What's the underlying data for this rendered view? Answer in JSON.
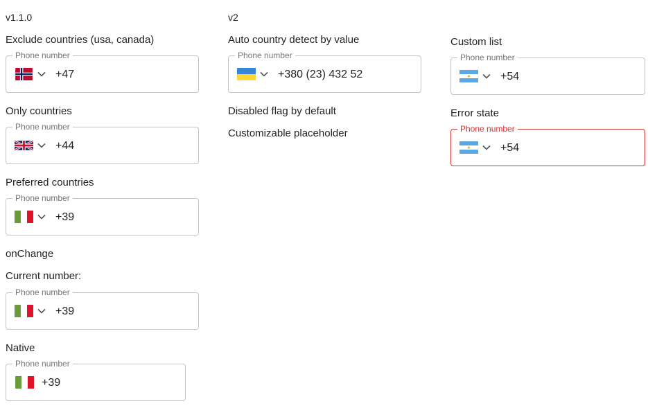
{
  "columns": {
    "v1": {
      "version": "v1.1.0",
      "fields": [
        {
          "label": "Exclude countries (usa, canada)",
          "placeholder": "Phone number",
          "value": "+47",
          "flag": "norway-flag-icon"
        },
        {
          "label": "Only countries",
          "placeholder": "Phone number",
          "value": "+44",
          "flag": "uk-flag-icon"
        },
        {
          "label": "Preferred countries",
          "placeholder": "Phone number",
          "value": "+39",
          "flag": "italy-flag-icon"
        }
      ],
      "onchange": {
        "label": "onChange",
        "current_label": "Current number:",
        "placeholder": "Phone number",
        "value": "+39",
        "flag": "italy-flag-icon"
      },
      "native": {
        "label": "Native",
        "placeholder": "Phone number",
        "value": "+39",
        "flag": "italy-flag-icon"
      }
    },
    "v2": {
      "version": "v2",
      "auto_detect": {
        "label": "Auto country detect by value",
        "placeholder": "Phone number",
        "value": "+380 (23) 432 52",
        "flag": "ukraine-flag-icon"
      },
      "disabled_flag_label": "Disabled flag by default",
      "custom_placeholder_label": "Customizable placeholder"
    },
    "v3": {
      "custom_list": {
        "label": "Custom list",
        "placeholder": "Phone number",
        "value": "+54",
        "flag": "argentina-flag-icon"
      },
      "error_state": {
        "label": "Error state",
        "placeholder": "Phone number",
        "value": "+54",
        "flag": "argentina-flag-icon",
        "border_color": "#d32f2f"
      }
    }
  },
  "colors": {
    "border": "#c4c4c4",
    "error": "#d32f2f",
    "legend": "#757575"
  }
}
